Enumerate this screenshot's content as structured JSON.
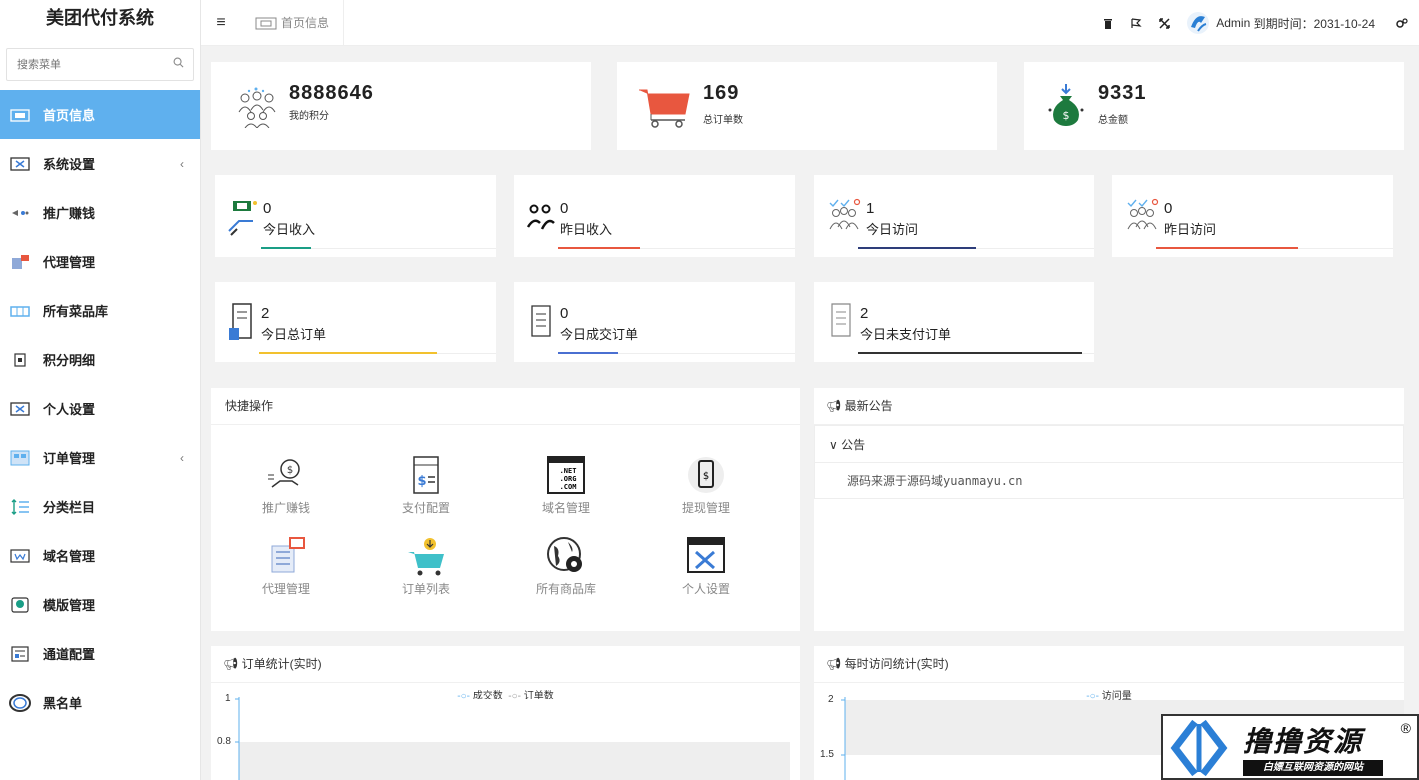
{
  "app": {
    "title": "美团代付系统"
  },
  "sidebar": {
    "search_placeholder": "搜索菜单",
    "items": [
      {
        "label": "首页信息",
        "icon": "home-icon"
      },
      {
        "label": "系统设置",
        "icon": "settings-icon",
        "arrow": "‹"
      },
      {
        "label": "推广赚钱",
        "icon": "promote-icon"
      },
      {
        "label": "代理管理",
        "icon": "agent-icon"
      },
      {
        "label": "所有菜品库",
        "icon": "dish-library-icon"
      },
      {
        "label": "积分明细",
        "icon": "points-icon"
      },
      {
        "label": "个人设置",
        "icon": "personal-icon"
      },
      {
        "label": "订单管理",
        "icon": "order-icon",
        "arrow": "‹"
      },
      {
        "label": "分类栏目",
        "icon": "category-icon"
      },
      {
        "label": "域名管理",
        "icon": "domain-icon"
      },
      {
        "label": "模版管理",
        "icon": "template-icon"
      },
      {
        "label": "通道配置",
        "icon": "channel-icon"
      },
      {
        "label": "黑名单",
        "icon": "blacklist-icon"
      }
    ]
  },
  "topbar": {
    "breadcrumb": "首页信息",
    "user": "Admin",
    "expire": "到期时间：2031-10-24"
  },
  "stats_big": [
    {
      "value": "8888646",
      "label": "我的积分"
    },
    {
      "value": "169",
      "label": "总订单数"
    },
    {
      "value": "9331",
      "label": "总金额"
    }
  ],
  "stats_small": [
    {
      "value": "0",
      "label": "今日收入",
      "color": "#1a9e86"
    },
    {
      "value": "0",
      "label": "昨日收入",
      "color": "#e8573f"
    },
    {
      "value": "1",
      "label": "今日访问",
      "color": "#2e3d7a"
    },
    {
      "value": "0",
      "label": "昨日访问",
      "color": "#e8573f"
    },
    {
      "value": "2",
      "label": "今日总订单",
      "color": "#f2c12e"
    },
    {
      "value": "0",
      "label": "今日成交订单",
      "color": "#4a6fd1"
    },
    {
      "value": "2",
      "label": "今日未支付订单",
      "color": "#333333"
    }
  ],
  "quick": {
    "title": "快捷操作",
    "items": [
      "推广赚钱",
      "支付配置",
      "域名管理",
      "提现管理",
      "代理管理",
      "订单列表",
      "所有商品库",
      "个人设置"
    ]
  },
  "notice": {
    "title": "最新公告",
    "section": "公告",
    "text": "源码来源于源码域yuanmayu.cn"
  },
  "order_chart": {
    "title": "订单统计(实时)",
    "legend": [
      "成交数",
      "订单数"
    ],
    "ticks": [
      "1",
      "0.8"
    ]
  },
  "visit_chart": {
    "title": "每时访问统计(实时)",
    "legend": [
      "访问量"
    ],
    "ticks": [
      "2",
      "1.5"
    ]
  },
  "watermark": {
    "title": "撸撸资源",
    "subtitle": "白嫖互联网资源的网站",
    "mark": "®"
  },
  "chart_data": [
    {
      "type": "line",
      "title": "订单统计(实时)",
      "series": [
        {
          "name": "成交数",
          "values": []
        },
        {
          "name": "订单数",
          "values": []
        }
      ],
      "ylim": [
        0.8,
        1
      ]
    },
    {
      "type": "line",
      "title": "每时访问统计(实时)",
      "series": [
        {
          "name": "访问量",
          "values": []
        }
      ],
      "ylim": [
        1.5,
        2
      ]
    }
  ]
}
